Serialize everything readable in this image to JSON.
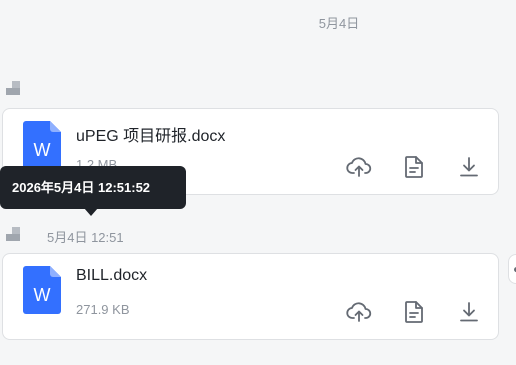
{
  "chat": {
    "date_divider": "5月4日",
    "messages": [
      {
        "meta": "",
        "file": {
          "name": "uPEG 项目研报.docx",
          "size": "1.2 MB",
          "type_letter": "W"
        }
      },
      {
        "meta": "5月4日 12:51",
        "file": {
          "name": "BILL.docx",
          "size": "271.9 KB",
          "type_letter": "W"
        }
      }
    ]
  },
  "tooltip": {
    "text": "2026年5月4日 12:51:52"
  },
  "icons": {
    "file_type": "word-doc-icon",
    "actions": [
      "cloud-upload-icon",
      "document-icon",
      "download-icon"
    ]
  },
  "colors": {
    "word_blue": "#3370ff",
    "tooltip_bg": "#1f2329",
    "meta_text": "#8f959e",
    "page_bg": "#f5f6f7"
  }
}
